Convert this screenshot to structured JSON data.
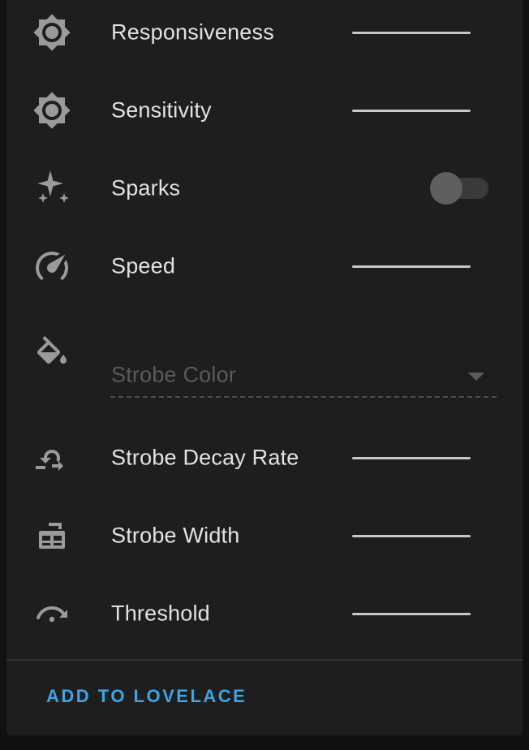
{
  "rows": [
    {
      "label": "Responsiveness",
      "icon": "brightness-icon",
      "control": "slider"
    },
    {
      "label": "Sensitivity",
      "icon": "brightness-icon",
      "control": "slider"
    },
    {
      "label": "Sparks",
      "icon": "sparkles-icon",
      "control": "toggle",
      "on": false
    },
    {
      "label": "Speed",
      "icon": "speedometer-icon",
      "control": "slider"
    },
    {
      "label": "Strobe Color",
      "icon": "paint-bucket-icon",
      "control": "select",
      "disabled": true
    },
    {
      "label": "Strobe Decay Rate",
      "icon": "restore-arrow-icon",
      "control": "slider"
    },
    {
      "label": "Strobe Width",
      "icon": "table-sized-icon",
      "control": "slider"
    },
    {
      "label": "Threshold",
      "icon": "arc-arrow-icon",
      "control": "slider"
    }
  ],
  "footer": {
    "action_label": "ADD TO LOVELACE"
  },
  "colors": {
    "card_bg": "#1e1e1e",
    "page_bg": "#111111",
    "icon": "#9a9a9a",
    "text": "#e3e3e3",
    "disabled_text": "#5a5a5a",
    "accent": "#3fa3e6"
  }
}
